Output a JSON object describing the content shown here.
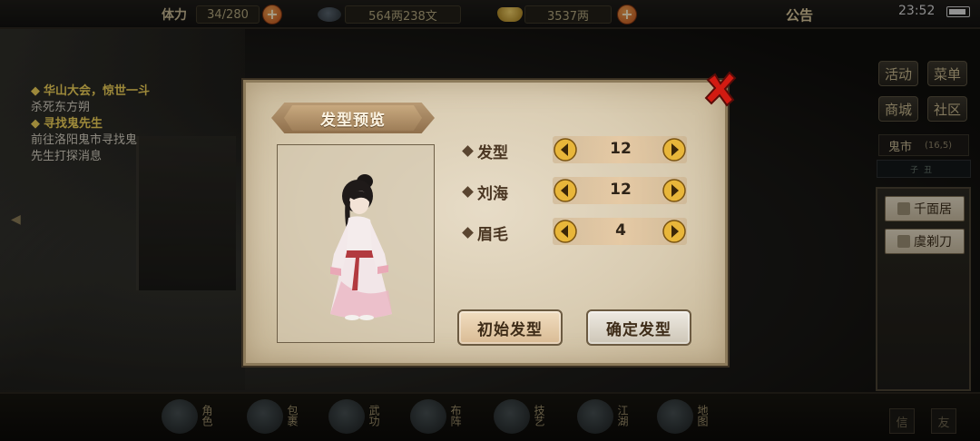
{
  "topbar": {
    "stamina_label": "体力",
    "stamina_value": "34/280",
    "silver_value": "564两238文",
    "gold_value": "3537两",
    "announce_label": "公告",
    "time": "23:52"
  },
  "quests": [
    {
      "title": "华山大会，惊世一斗",
      "desc": "杀死东方朔"
    },
    {
      "title": "寻找鬼先生",
      "desc": "前往洛阳鬼市寻找鬼先生打探消息"
    }
  ],
  "right_panel": {
    "activity_label": "活动",
    "menu_label": "菜单",
    "shop_label": "商城",
    "community_label": "社区",
    "location": "鬼市",
    "coords": "(16,5)",
    "timebar": "子丑",
    "npcs": [
      "千面居",
      "虞剃刀"
    ]
  },
  "bottom_menu": [
    "角色",
    "包裹",
    "武功",
    "布阵",
    "技艺",
    "江湖",
    "地图"
  ],
  "bottom_small": [
    "信",
    "友"
  ],
  "dialog": {
    "title": "发型预览",
    "options": [
      {
        "label": "发型",
        "value": "12"
      },
      {
        "label": "刘海",
        "value": "12"
      },
      {
        "label": "眉毛",
        "value": "4"
      }
    ],
    "init_button": "初始发型",
    "confirm_button": "确定发型"
  },
  "colors": {
    "parchment": "#ddd0b6",
    "quest_title": "#f2d35a",
    "close_red": "#d21b12",
    "arrow_gold": "#e8b63a"
  }
}
